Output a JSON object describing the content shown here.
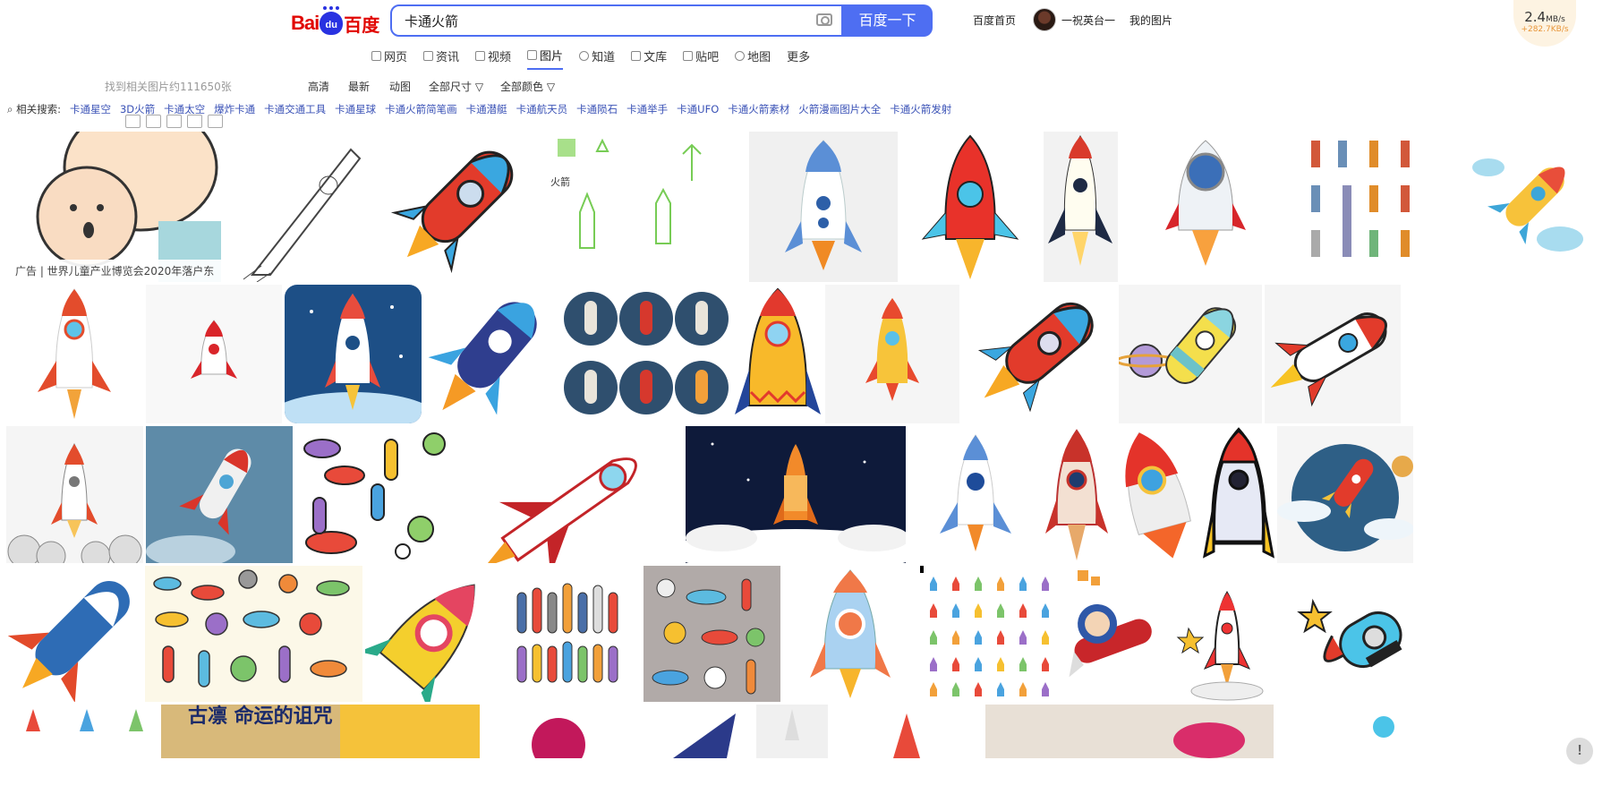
{
  "header": {
    "logo_bai": "Bai",
    "logo_du": "du",
    "logo_baidu": "百度",
    "search_value": "卡通火箭",
    "search_button": "百度一下",
    "links": [
      "百度首页",
      "一祝英台一",
      "我的图片"
    ],
    "speed_main": "2.4",
    "speed_unit": "MB/s",
    "speed_sub": "+282.7KB/s"
  },
  "tabs": [
    {
      "label": "网页",
      "icon": "web-icon"
    },
    {
      "label": "资讯",
      "icon": "news-icon"
    },
    {
      "label": "视频",
      "icon": "video-icon"
    },
    {
      "label": "图片",
      "icon": "image-icon",
      "active": true
    },
    {
      "label": "知道",
      "icon": "question-icon"
    },
    {
      "label": "文库",
      "icon": "doc-icon"
    },
    {
      "label": "贴吧",
      "icon": "tieba-icon"
    },
    {
      "label": "地图",
      "icon": "map-icon"
    },
    {
      "label": "更多",
      "icon": ""
    }
  ],
  "filters": {
    "count": "找到相关图片约111650张",
    "options": [
      "高清",
      "最新",
      "动图",
      "全部尺寸 ▽",
      "全部颜色 ▽"
    ]
  },
  "related": {
    "label": "相关搜索:",
    "items": [
      "卡通星空",
      "3D火箭",
      "卡通太空",
      "爆炸卡通",
      "卡通交通工具",
      "卡通星球",
      "卡通火箭简笔画",
      "卡通潜艇",
      "卡通航天员",
      "卡通陨石",
      "卡通举手",
      "卡通UFO",
      "卡通火箭素材",
      "火箭漫画图片大全",
      "卡通火箭发射"
    ]
  },
  "ad": "广告 | 世界儿童产业博览会2020年落户东",
  "thumb_text": {
    "sketch_title": "火箭",
    "banner": "古凛 命运的诅咒"
  },
  "feedback": "!",
  "colors": {
    "accent": "#4e6ef2",
    "logo_red": "#e10601",
    "link": "#3951b6"
  }
}
